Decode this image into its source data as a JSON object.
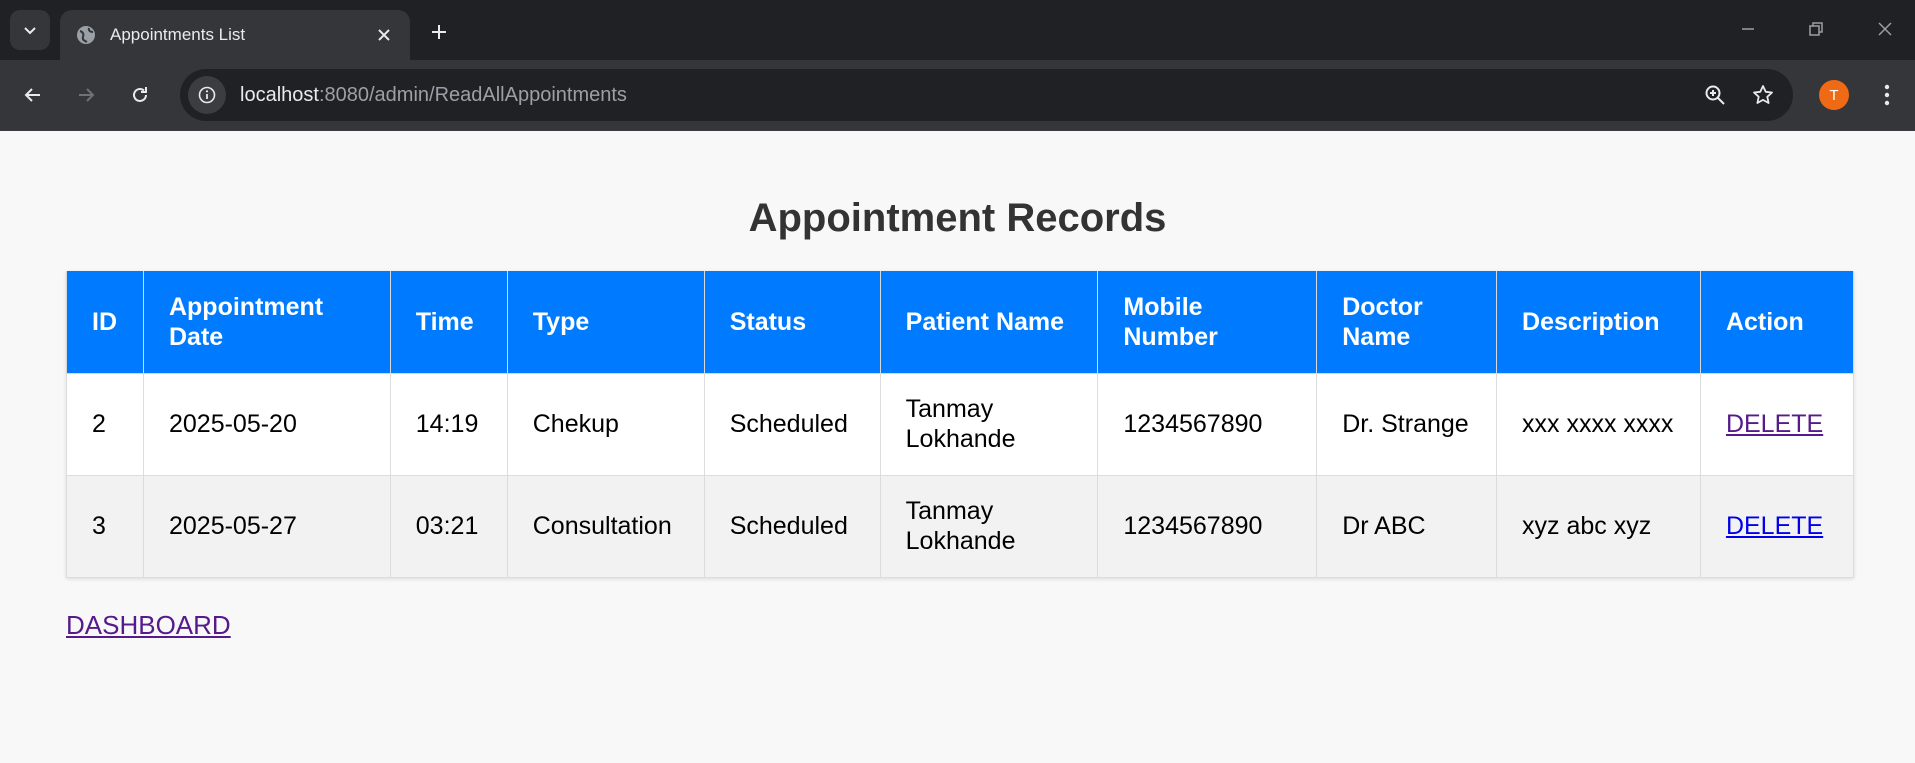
{
  "browser": {
    "tab_title": "Appointments List",
    "url_host": "localhost",
    "url_path": ":8080/admin/ReadAllAppointments",
    "profile_initial": "T",
    "profile_color": "#f06a15"
  },
  "page": {
    "title": "Appointment Records",
    "header_color": "#007bff",
    "columns": [
      "ID",
      "Appointment Date",
      "Time",
      "Type",
      "Status",
      "Patient Name",
      "Mobile Number",
      "Doctor Name",
      "Description",
      "Action"
    ],
    "rows": [
      {
        "id": "2",
        "date": "2025-05-20",
        "time": "14:19",
        "type": "Chekup",
        "status": "Scheduled",
        "patient": "Tanmay Lokhande",
        "mobile": "1234567890",
        "doctor": "Dr. Strange",
        "description": "xxx xxxx xxxx",
        "action": "DELETE"
      },
      {
        "id": "3",
        "date": "2025-05-27",
        "time": "03:21",
        "type": "Consultation",
        "status": "Scheduled",
        "patient": "Tanmay Lokhande",
        "mobile": "1234567890",
        "doctor": "Dr ABC",
        "description": "xyz abc xyz",
        "action": "DELETE"
      }
    ],
    "dashboard_link": "DASHBOARD"
  }
}
